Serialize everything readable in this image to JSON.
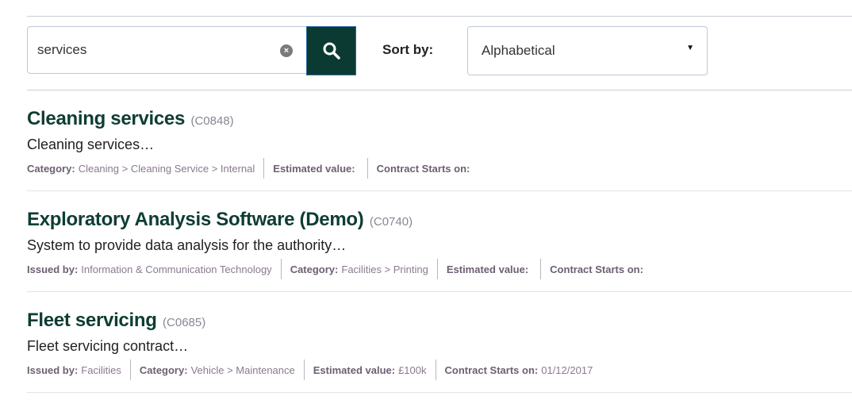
{
  "search": {
    "value": "services",
    "placeholder": "",
    "clear_glyph": "×",
    "button_icon": "search-icon"
  },
  "sort": {
    "label": "Sort by:",
    "selected": "Alphabetical",
    "caret": "▼"
  },
  "results": [
    {
      "title": "Cleaning services",
      "code": "(C0848)",
      "description": "Cleaning services…",
      "meta": [
        {
          "key": "Category:",
          "value": "Cleaning > Cleaning Service > Internal"
        },
        {
          "key": "Estimated value:",
          "value": ""
        },
        {
          "key": "Contract Starts on:",
          "value": ""
        }
      ]
    },
    {
      "title": "Exploratory Analysis Software (Demo)",
      "code": "(C0740)",
      "description": "System to provide data analysis for the authority…",
      "meta": [
        {
          "key": "Issued by:",
          "value": "Information & Communication Technology"
        },
        {
          "key": "Category:",
          "value": "Facilities > Printing"
        },
        {
          "key": "Estimated value:",
          "value": ""
        },
        {
          "key": "Contract Starts on:",
          "value": ""
        }
      ]
    },
    {
      "title": "Fleet servicing",
      "code": "(C0685)",
      "description": "Fleet servicing contract…",
      "meta": [
        {
          "key": "Issued by:",
          "value": "Facilities"
        },
        {
          "key": "Category:",
          "value": "Vehicle > Maintenance"
        },
        {
          "key": "Estimated value:",
          "value": "£100k"
        },
        {
          "key": "Contract Starts on:",
          "value": "01/12/2017"
        }
      ]
    }
  ],
  "colors": {
    "title": "#0e3d33",
    "search_button": "#0b3a32",
    "meta_value": "#8a7a8e"
  }
}
